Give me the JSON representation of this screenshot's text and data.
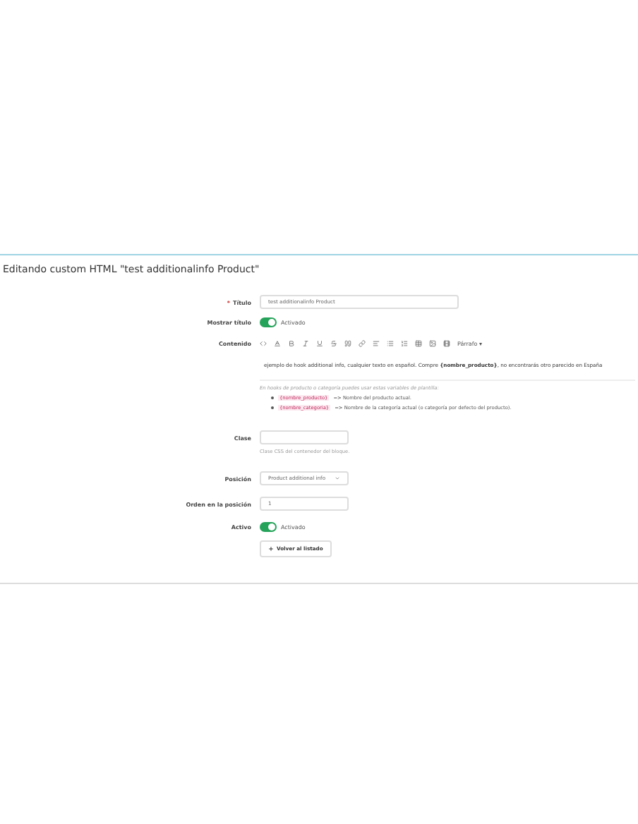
{
  "page_title": "Editando custom HTML \"test additionalinfo Product\"",
  "title_field": {
    "label": "Título",
    "required_mark": "*",
    "value": "test additionalinfo Product"
  },
  "show_title": {
    "label": "Mostrar título",
    "on": true,
    "state_text": "Activado"
  },
  "content": {
    "label": "Contenido",
    "format_menu": "Párrafo ▾",
    "body": "ejemplo de hook additional info, cualquier texto en español. Compre **{nombre_producto}**, no encontrarás otro parecido en España",
    "help": "En hooks de producto o categoría puedes usar estas variables de plantilla:",
    "variables": [
      {
        "token": "{nombre_producto}",
        "description": "=> Nombre del producto actual."
      },
      {
        "token": "{nombre_categoria}",
        "description": "=> Nombre de la categoría actual (o categoría por defecto del producto)."
      }
    ]
  },
  "css_class": {
    "label": "Clase",
    "help": "Clase CSS del contenedor del bloque."
  },
  "position": {
    "label": "Posición",
    "value": "Product additional info"
  },
  "order": {
    "label": "Orden en la posición",
    "value": "1"
  },
  "active": {
    "label": "Activo",
    "on": true,
    "state_text": "Activado"
  },
  "back_button": "Volver al listado"
}
